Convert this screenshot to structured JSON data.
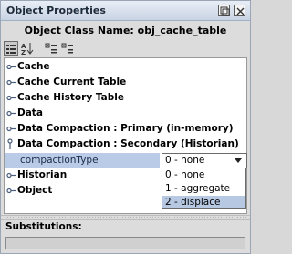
{
  "window": {
    "title": "Object Properties"
  },
  "header": {
    "class_name": "Object Class Name: obj_cache_table"
  },
  "toolbar": {
    "icons": [
      "categorized-view-icon",
      "sort-alpha-icon",
      "expand-all-icon",
      "collapse-all-icon"
    ]
  },
  "tree": {
    "groups": [
      {
        "label": "Cache",
        "expanded": false
      },
      {
        "label": "Cache Current Table",
        "expanded": false
      },
      {
        "label": "Cache History Table",
        "expanded": false
      },
      {
        "label": "Data",
        "expanded": false
      },
      {
        "label": "Data Compaction : Primary (in-memory)",
        "expanded": false
      },
      {
        "label": "Data Compaction : Secondary (Historian)",
        "expanded": true
      },
      {
        "label": "Historian",
        "expanded": false
      },
      {
        "label": "Object",
        "expanded": false
      }
    ],
    "property": {
      "name": "compactionType",
      "value": "0 - none",
      "options": [
        "0 - none",
        "1 - aggregate",
        "2 - displace"
      ],
      "highlighted_option": "2 - displace"
    }
  },
  "substitutions": {
    "label": "Substitutions:",
    "value": ""
  },
  "colors": {
    "selection": "#b9cbe6",
    "title_bar": "#c8d3e3"
  }
}
